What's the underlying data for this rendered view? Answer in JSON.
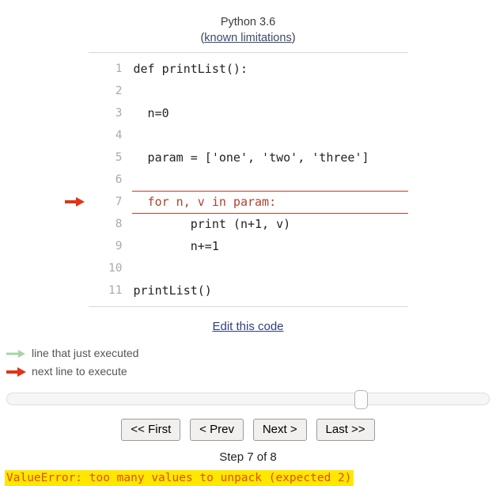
{
  "header": {
    "python_version": "Python 3.6",
    "limitations_prefix": "(",
    "limitations_link": "known limitations",
    "limitations_suffix": ")"
  },
  "code": {
    "lines": [
      {
        "number": "1",
        "text": "def printList():",
        "state": "normal"
      },
      {
        "number": "2",
        "text": "",
        "state": "normal"
      },
      {
        "number": "3",
        "text": "  n=0",
        "state": "normal"
      },
      {
        "number": "4",
        "text": "",
        "state": "normal"
      },
      {
        "number": "5",
        "text": "  param = ['one', 'two', 'three']",
        "state": "normal"
      },
      {
        "number": "6",
        "text": "",
        "state": "normal"
      },
      {
        "number": "7",
        "text": "  for n, v in param:",
        "state": "next"
      },
      {
        "number": "8",
        "text": "        print (n+1, v)",
        "state": "normal"
      },
      {
        "number": "9",
        "text": "        n+=1",
        "state": "normal"
      },
      {
        "number": "10",
        "text": "",
        "state": "normal"
      },
      {
        "number": "11",
        "text": "printList()",
        "state": "normal"
      }
    ]
  },
  "edit_link": {
    "label": "Edit this code"
  },
  "legend": {
    "items": [
      {
        "icon": "green-arrow-icon",
        "label": "line that just executed",
        "color": "#a8d4a8"
      },
      {
        "icon": "red-arrow-icon",
        "label": "next line to execute",
        "color": "#e03418"
      }
    ]
  },
  "slider": {
    "value_percent": 74,
    "name": "execution-step-slider"
  },
  "controls": {
    "first_label": "<< First",
    "prev_label": "< Prev",
    "next_label": "Next >",
    "last_label": "Last >>"
  },
  "status": {
    "step_label": "Step 7 of 8"
  },
  "error": {
    "message": "ValueError: too many values to unpack (expected 2)",
    "text_color": "#e24a17",
    "highlight_color": "#ffe800"
  },
  "colors": {
    "next_line_border": "#b44030",
    "line_number": "#aaaaaa",
    "link": "#33407a",
    "code_text": "#222222"
  }
}
